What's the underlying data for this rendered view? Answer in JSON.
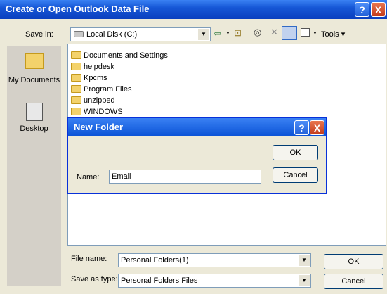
{
  "window": {
    "title": "Create or Open Outlook Data File",
    "help": "?",
    "close": "X"
  },
  "toolbar": {
    "save_in_label": "Save in:",
    "save_in_value": "Local Disk (C:)",
    "tools_label": "Tools"
  },
  "places": [
    {
      "label": "My Documents"
    },
    {
      "label": "Desktop"
    }
  ],
  "files": [
    {
      "name": "Documents and Settings"
    },
    {
      "name": "helpdesk"
    },
    {
      "name": "Kpcms"
    },
    {
      "name": "Program Files"
    },
    {
      "name": "unzipped"
    },
    {
      "name": "WINDOWS"
    }
  ],
  "bottom": {
    "file_name_label": "File name:",
    "file_name_value": "Personal Folders(1)",
    "save_as_label": "Save as type:",
    "save_as_value": "Personal Folders Files",
    "ok": "OK",
    "cancel": "Cancel"
  },
  "new_folder": {
    "title": "New Folder",
    "name_label": "Name:",
    "name_value": "Email",
    "ok": "OK",
    "cancel": "Cancel"
  },
  "colors": {
    "title_bar": "#1657d6",
    "close_button": "#c23b1c",
    "window_bg": "#ece9d8"
  }
}
